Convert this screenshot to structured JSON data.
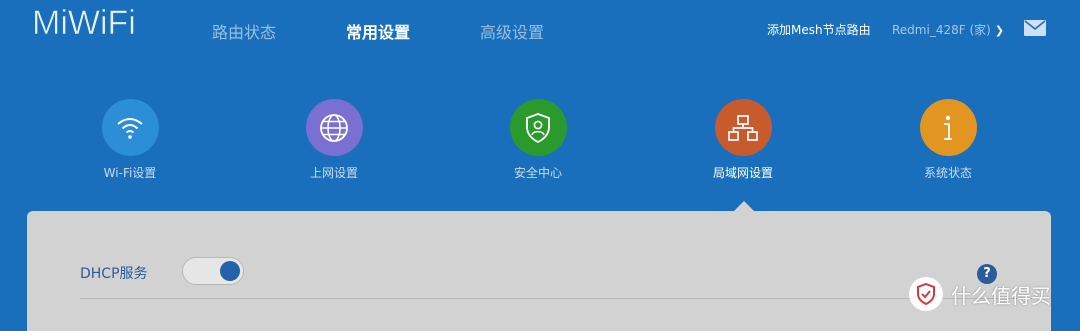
{
  "logo": "MiWiFi",
  "nav": {
    "tabs": [
      {
        "label": "路由状态"
      },
      {
        "label": "常用设置"
      },
      {
        "label": "高级设置"
      }
    ],
    "active_index": 1
  },
  "header_right": {
    "mesh_link": "添加Mesh节点路由",
    "router_name": "Redmi_428F (家)",
    "chevron_icon": "chevron-down-icon",
    "mail_icon": "mail-icon"
  },
  "modules": [
    {
      "label": "Wi-Fi设置",
      "icon": "wifi-icon",
      "color": "#2c8ed6"
    },
    {
      "label": "上网设置",
      "icon": "globe-icon",
      "color": "#7a6fd3"
    },
    {
      "label": "安全中心",
      "icon": "shield-user-icon",
      "color": "#2b9a2d"
    },
    {
      "label": "局域网设置",
      "icon": "network-icon",
      "color": "#c75b2d"
    },
    {
      "label": "系统状态",
      "icon": "info-icon",
      "color": "#e29521"
    }
  ],
  "active_module": 3,
  "panel": {
    "dhcp_label": "DHCP服务",
    "dhcp_enabled": true,
    "help": "?"
  },
  "watermark": {
    "text": "什么值得买"
  }
}
